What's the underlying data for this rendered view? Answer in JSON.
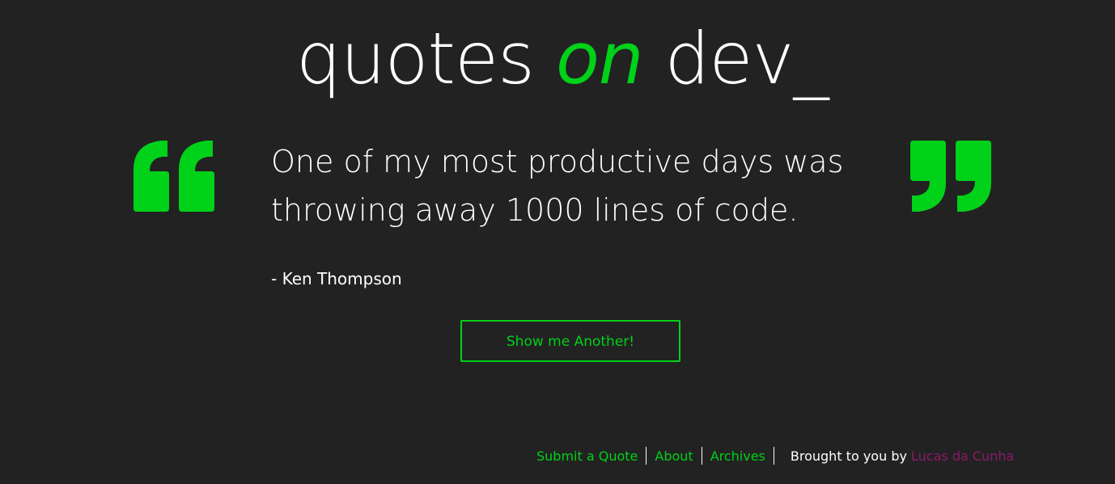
{
  "header": {
    "logo_part1": "quotes ",
    "logo_part2": "on",
    "logo_part3": " dev_"
  },
  "quote": {
    "text": "One of my most productive days was throwing away 1000 lines of code.",
    "author": "- Ken Thompson",
    "open_mark_icon": "open-quote-icon",
    "close_mark_icon": "close-quote-icon"
  },
  "actions": {
    "another_label": "Show me Another!"
  },
  "footer": {
    "links": [
      "Submit a Quote",
      "About",
      "Archives"
    ],
    "credit_prefix": "Brought to you by ",
    "credit_name": "Lucas da Cunha"
  },
  "colors": {
    "background": "#222222",
    "accent": "#00d119",
    "credit": "#8b1a6b",
    "text": "#ffffff"
  }
}
